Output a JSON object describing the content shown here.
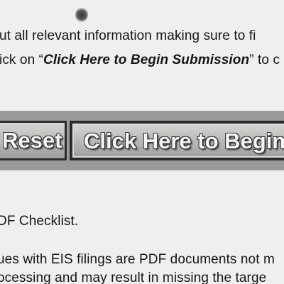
{
  "instructions": {
    "line_1": "ut all relevant information making sure to fi",
    "line_2_prefix": "ick on “",
    "line_2_link": "Click Here to Begin Submission",
    "line_2_suffix": "” to c"
  },
  "buttons": {
    "reset_label": "Reset",
    "begin_label": "Click Here to Begin S"
  },
  "notes": {
    "checklist": "DF Checklist.",
    "issues_line_1": "ues with EIS filings are PDF documents not m",
    "issues_line_2": "ocessing and may result in missing the targe"
  }
}
